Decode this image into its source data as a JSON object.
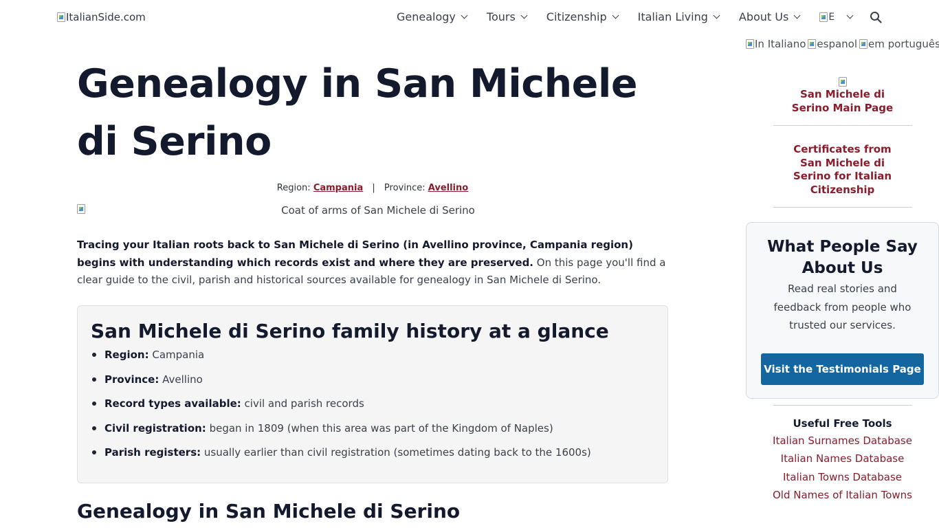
{
  "header": {
    "logo_alt": "ItalianSide.com",
    "nav": [
      {
        "label": "Genealogy"
      },
      {
        "label": "Tours"
      },
      {
        "label": "Citizenship"
      },
      {
        "label": "Italian Living"
      },
      {
        "label": "About Us"
      }
    ],
    "language_flag_alt": "E",
    "icons": {
      "search": "search-icon",
      "dropdown": "chevron-down-icon"
    }
  },
  "language_links": [
    "In Italiano",
    "espanol",
    "em português"
  ],
  "main": {
    "title": "Genealogy in San Michele di Serino",
    "region_label": "Region:",
    "region_value": "Campania",
    "separator": "|",
    "province_label": "Province:",
    "province_value": "Avellino",
    "coat_caption": "Coat of arms of San Michele di Serino",
    "intro_bold": "Tracing your Italian roots back to San Michele di Serino (in Avellino province, Campania region) begins with understanding which records exist and where they are preserved.",
    "intro_rest": " On this page you'll find a clear guide to the civil, parish and historical sources available for genealogy in San Michele di Serino.",
    "glance": {
      "heading": "San Michele di Serino family history at a glance",
      "items": [
        {
          "label": "Region:",
          "value": " Campania"
        },
        {
          "label": "Province:",
          "value": " Avellino"
        },
        {
          "label": "Record types available:",
          "value": " civil and parish records"
        },
        {
          "label": "Civil registration:",
          "value": " began in 1809 (when this area was part of the Kingdom of Naples)"
        },
        {
          "label": "Parish registers:",
          "value": " usually earlier than civil registration (sometimes dating back to the 1600s)"
        }
      ]
    },
    "subheading": "Genealogy in San Michele di Serino"
  },
  "sidebar": {
    "main_page_link": "San Michele di Serino Main Page",
    "certificates_link": "Certificates from San Michele di Serino for Italian Citizenship",
    "testimonials": {
      "heading": "What People Say About Us",
      "text": "Read real stories and feedback from people who trusted our services.",
      "button": "Visit the Testimonials Page"
    },
    "tools": {
      "heading": "Useful Free Tools",
      "links": [
        "Italian Surnames Database",
        "Italian Names Database",
        "Italian Towns Database",
        "Old Names of Italian Towns"
      ]
    }
  },
  "colors": {
    "accent": "#8b1c2b",
    "button": "#1366a0",
    "heading": "#141a2e"
  }
}
